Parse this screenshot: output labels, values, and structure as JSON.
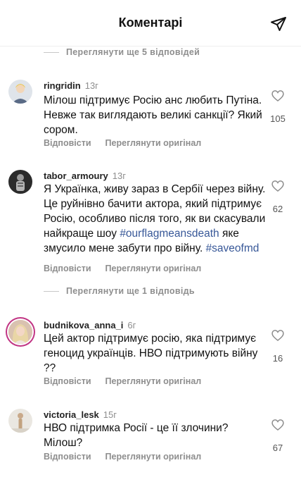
{
  "header": {
    "title": "Коментарі"
  },
  "view_replies_1": "Переглянути ще 5 відповідей",
  "view_replies_2": "Переглянути ще 1 відповідь",
  "comments": [
    {
      "username": "ringridin",
      "time": "13г",
      "text": "Мілош підтримує Росію анс любить Путіна. Невже так виглядають великі санкції? Який сором.",
      "likes": "105",
      "reply": "Відповісти",
      "translate": "Переглянути оригінал"
    },
    {
      "username": "tabor_armoury",
      "time": "13г",
      "text_before": "Я Українка, живу зараз в Сербії через війну. Це руйнівно бачити актора, який підтримує Росію, особливо після того, як ви скасували найкраще шоу ",
      "hashtag1": "#ourflagmeansdeath",
      "text_middle": " яке змусило мене забути про війну. ",
      "hashtag2": "#saveofmd",
      "likes": "62",
      "reply": "Відповісти",
      "translate": "Переглянути оригінал"
    },
    {
      "username": "budnikova_anna_i",
      "time": "6г",
      "text": "Цей актор підтримує росію, яка підтримує геноцид українців. НВО підтримують війну ??",
      "likes": "16",
      "reply": "Відповісти",
      "translate": "Переглянути оригінал"
    },
    {
      "username": "victoria_lesk",
      "time": "15г",
      "text": "НВО підтримка Росії - це її злочини? Мілош?",
      "likes": "67",
      "reply": "Відповісти",
      "translate": "Переглянути оригінал"
    }
  ]
}
